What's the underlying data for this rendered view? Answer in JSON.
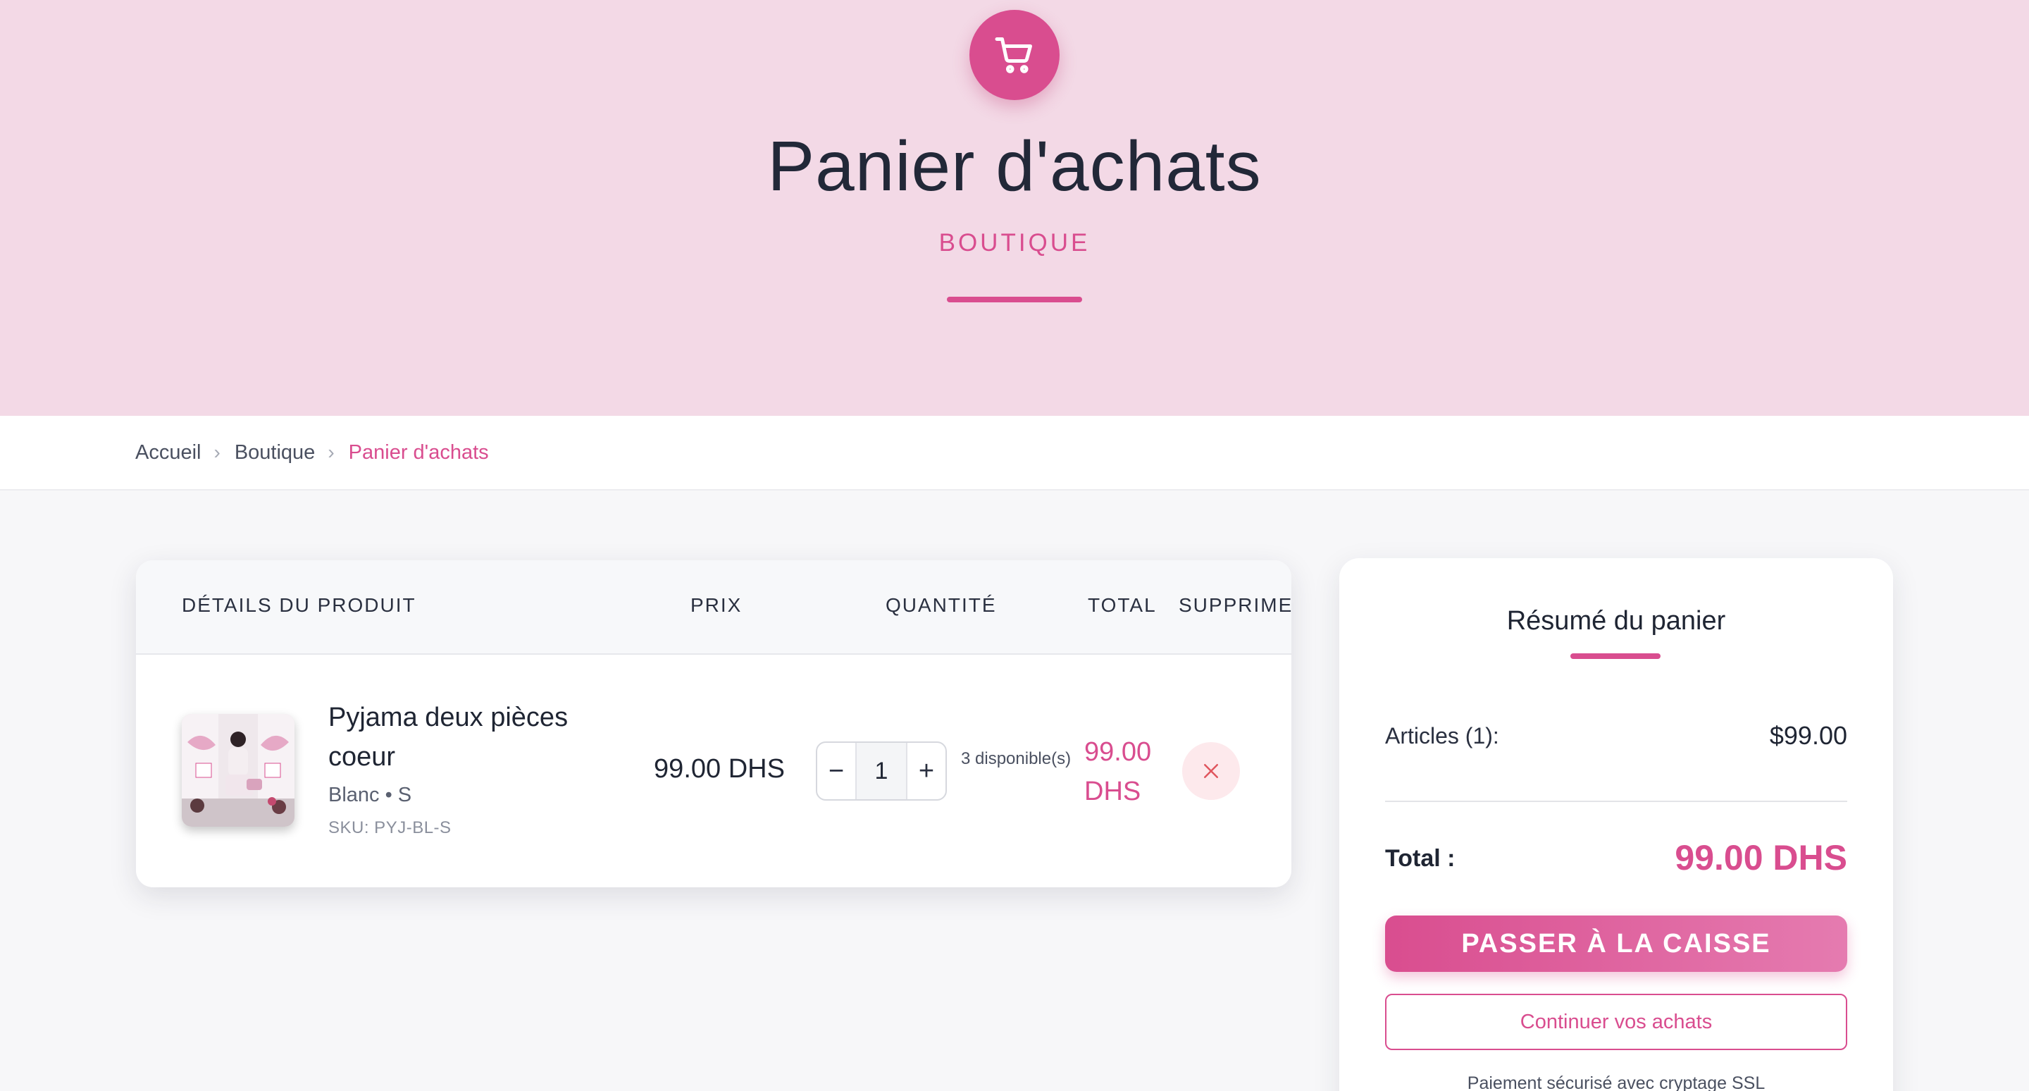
{
  "header": {
    "icon": "shopping-cart-icon",
    "title": "Panier d'achats",
    "subtitle": "BOUTIQUE"
  },
  "breadcrumb": {
    "items": [
      "Accueil",
      "Boutique",
      "Panier d'achats"
    ]
  },
  "cart": {
    "columns": [
      "DÉTAILS DU PRODUIT",
      "PRIX",
      "QUANTITÉ",
      "TOTAL",
      "SUPPRIMER"
    ],
    "items": [
      {
        "name": "Pyjama deux pièces coeur",
        "variant": "Blanc • S",
        "sku": "SKU: PYJ-BL-S",
        "price": "99.00 DHS",
        "quantity": "1",
        "stock": "3 disponible(s)",
        "total": "99.00 DHS"
      }
    ]
  },
  "summary": {
    "title": "Résumé du panier",
    "articles_label": "Articles (1):",
    "articles_value": "$99.00",
    "total_label": "Total :",
    "total_value": "99.00 DHS",
    "checkout_label": "PASSER À LA CAISSE",
    "continue_label": "Continuer vos achats",
    "secure_note": "Paiement sécurisé avec cryptage SSL"
  },
  "colors": {
    "accent": "#d94d8f",
    "hero_bg": "#f3d9e6"
  }
}
